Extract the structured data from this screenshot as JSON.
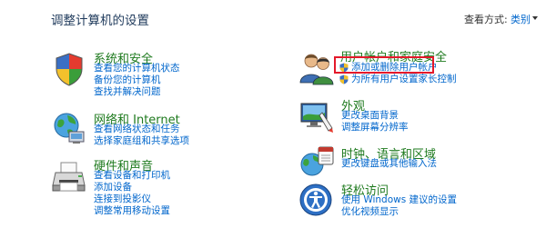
{
  "page": {
    "title": "调整计算机的设置",
    "view_by_label": "查看方式:",
    "view_by_value": "类别"
  },
  "left_column": {
    "system_security": {
      "title": "系统和安全",
      "links": [
        "查看您的计算机状态",
        "备份您的计算机",
        "查找并解决问题"
      ]
    },
    "network_internet": {
      "title": "网络和 Internet",
      "links": [
        "查看网络状态和任务",
        "选择家庭组和共享选项"
      ]
    },
    "hardware_sound": {
      "title": "硬件和声音",
      "links": [
        "查看设备和打印机",
        "添加设备",
        "连接到投影仪",
        "调整常用移动设置"
      ]
    }
  },
  "right_column": {
    "user_accounts": {
      "title": "用户帐户和家庭安全",
      "links": [
        "添加或删除用户帐户",
        "为所有用户设置家长控制"
      ]
    },
    "appearance": {
      "title": "外观",
      "links": [
        "更改桌面背景",
        "调整屏幕分辨率"
      ]
    },
    "clock_region": {
      "title": "时钟、语言和区域",
      "links": [
        "更改键盘或其他输入法"
      ]
    },
    "ease_access": {
      "title": "轻松访问",
      "links": [
        "使用 Windows 建议的设置",
        "优化视频显示"
      ]
    }
  },
  "colors": {
    "category_title": "#1e7a1e",
    "link": "#0066cc",
    "highlight": "#e4192a"
  },
  "icons": [
    "security-shield-icon",
    "network-globe-icon",
    "printer-icon",
    "users-icon",
    "appearance-display-icon",
    "clock-globe-icon",
    "ease-of-access-icon",
    "uac-shield-icon"
  ]
}
